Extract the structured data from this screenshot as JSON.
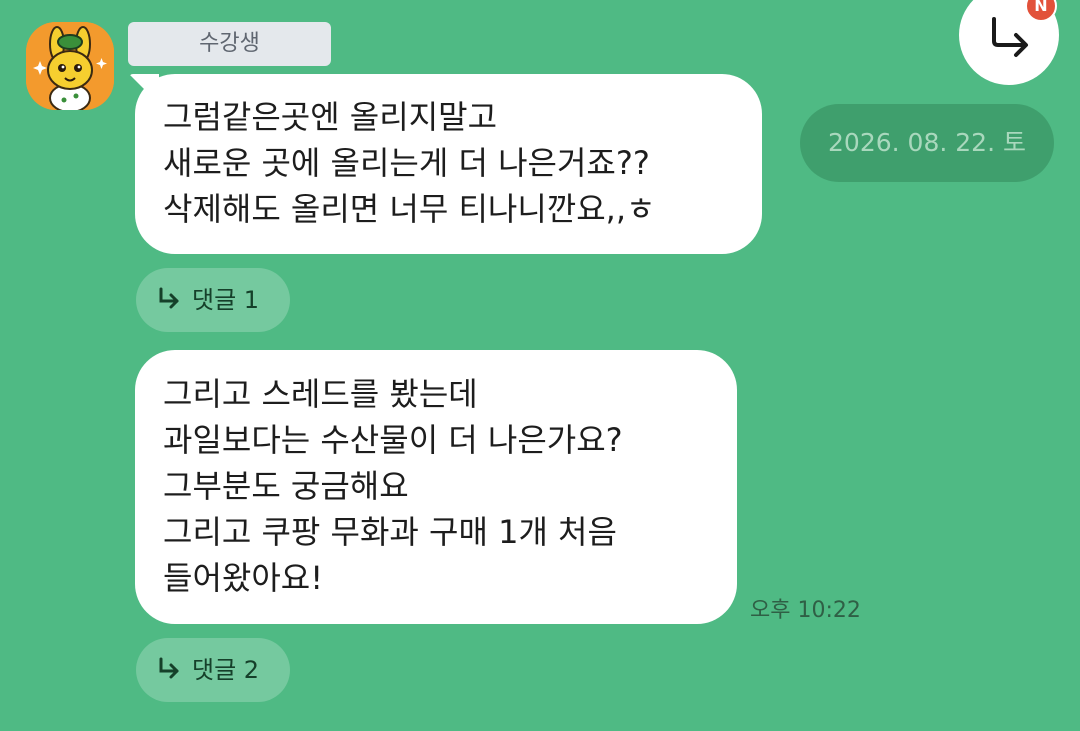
{
  "sender": {
    "name": "수강생",
    "avatar_icon": "bunny-character-icon"
  },
  "messages": [
    {
      "lines": [
        "그럼같은곳엔 올리지말고",
        "새로운 곳에 올리는게 더 나은거죠??",
        "삭제해도 올리면 너무 티나니깐요,,ㅎ"
      ],
      "reply_label": "댓글 1"
    },
    {
      "lines": [
        "그리고 스레드를 봤는데",
        "과일보다는 수산물이 더 나은가요?",
        "그부분도 궁금해요",
        "그리고 쿠팡 무화과 구매 1개 처음",
        "들어왔아요!"
      ],
      "time": "오후 10:22",
      "reply_label": "댓글 2"
    }
  ],
  "date_label": "2026. 08. 22. 토",
  "share_button": {
    "icon": "reply-arrow-icon",
    "badge": "N"
  },
  "colors": {
    "background": "#4fba84",
    "bubble": "#ffffff",
    "badge": "#e2513a"
  }
}
